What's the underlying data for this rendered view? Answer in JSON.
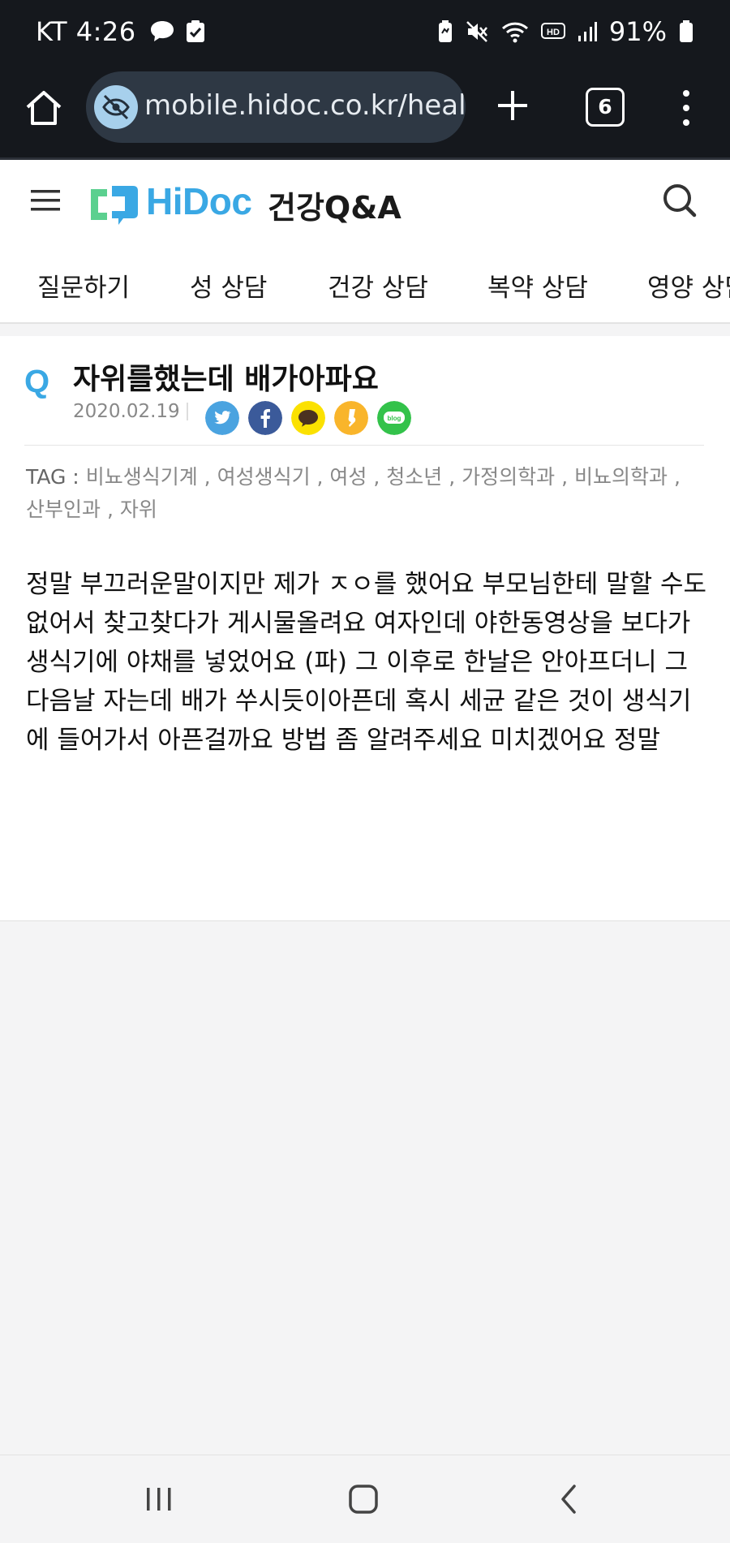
{
  "status_bar": {
    "carrier_time": "KT 4:26",
    "battery_pct": "91%",
    "left_icons": [
      "talk-bubble-icon",
      "check-box-icon"
    ],
    "right_icons": [
      "battery-saver-icon",
      "mute-icon",
      "wifi-icon",
      "hd-icon",
      "signal-icon",
      "battery-icon"
    ]
  },
  "browser": {
    "url": "mobile.hidoc.co.kr/healtl",
    "tab_count": "6"
  },
  "site": {
    "logo_text": "HiDoc",
    "section_title": "건강Q&A",
    "brand_color": "#3aa8e4"
  },
  "categories": [
    "질문하기",
    "성 상담",
    "건강 상담",
    "복약 상담",
    "영양 상담"
  ],
  "article": {
    "q_mark": "Q",
    "title": "자위를했는데 배가아파요",
    "date": "2020.02.19",
    "share_buttons": [
      "twitter",
      "facebook",
      "kakaotalk",
      "kakaostory",
      "blog"
    ],
    "share_blog_label": "blog",
    "tag_label": "TAG :",
    "tags": [
      "비뇨생식기계",
      "여성생식기",
      "여성",
      "청소년",
      "가정의학과",
      "비뇨의학과",
      "산부인과",
      "자위"
    ],
    "body": "정말 부끄러운말이지만 제가 ㅈㅇ를 했어요 부모님한테 말할 수도 없어서 찾고찾다가 게시물올려요 여자인데 야한동영상을 보다가 생식기에 야채를 넣었어요 (파) 그 이후로 한날은 안아프더니 그다음날 자는데 배가 쑤시듯이아픈데 혹시 세균 같은 것이 생식기에 들어가서 아픈걸까요 방법 좀 알려주세요 미치겠어요 정말"
  }
}
